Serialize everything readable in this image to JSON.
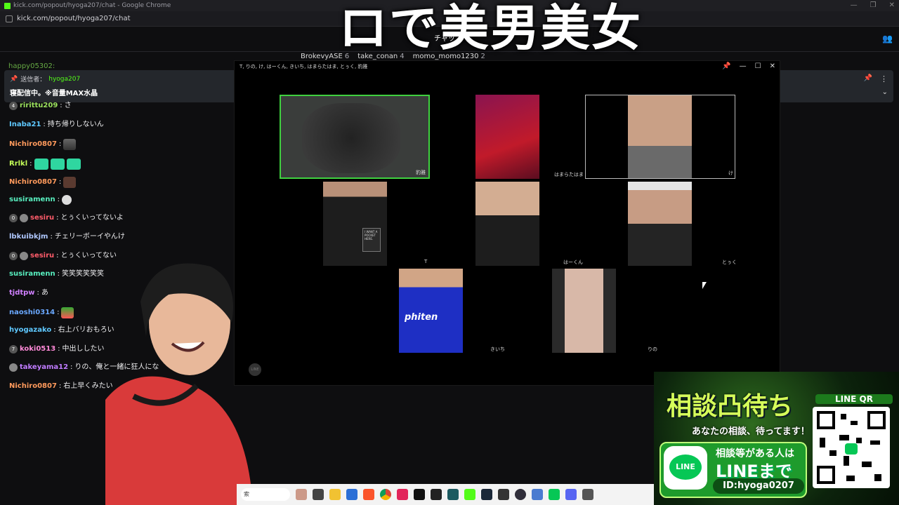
{
  "browser": {
    "title": "kick.com/popout/hyoga207/chat - Google Chrome",
    "url": "kick.com/popout/hyoga207/chat"
  },
  "overlay": {
    "caption": "ロで美男美女",
    "small_caption": "チャッ"
  },
  "top_gifters": [
    {
      "name": "BrokevyASE",
      "count": "6"
    },
    {
      "name": "take_conan",
      "count": "4"
    },
    {
      "name": "momo_momo1230",
      "count": "2"
    }
  ],
  "chat_partial_top": "happy05302:",
  "pinned": {
    "sender_label": "送信者：",
    "sender_name": "hyoga207",
    "message": "寝配信中。※音量MAX水晶"
  },
  "chat": [
    {
      "badge": "4",
      "user": "ririttu209",
      "text": "さ",
      "color": "#9be15d"
    },
    {
      "badge": "",
      "user": "Inaba21",
      "text": "持ち帰りしないん",
      "color": "#5ec8ff"
    },
    {
      "badge": "",
      "user": "Nichiro0807",
      "text": "",
      "color": "#ff9a5c"
    },
    {
      "badge": "",
      "user": "Rrlkl",
      "text": "",
      "color": "#c4ff58"
    },
    {
      "badge": "",
      "user": "Nichiro0807",
      "text": "",
      "color": "#ff9a5c"
    },
    {
      "badge": "",
      "user": "susiramenn",
      "text": "",
      "color": "#58f0c0"
    },
    {
      "badge": "0",
      "user": "sesiru",
      "text": "とぅくいってないよ",
      "color": "#ff5c6a"
    },
    {
      "badge": "",
      "user": "lbkuibkjm",
      "text": "チェリーボーイやんけ",
      "color": "#b0c8ff"
    },
    {
      "badge": "0",
      "user": "sesiru",
      "text": "とぅくいってない",
      "color": "#ff5c6a"
    },
    {
      "badge": "",
      "user": "susiramenn",
      "text": "笑笑笑笑笑笑",
      "color": "#58f0c0"
    },
    {
      "badge": "",
      "user": "tjdtpw",
      "text": "あ",
      "color": "#d080ff"
    },
    {
      "badge": "",
      "user": "naoshi0314",
      "text": "",
      "color": "#6aa8ff"
    },
    {
      "badge": "",
      "user": "hyogazako",
      "text": "右上バリおもろい",
      "color": "#5ec8ff"
    },
    {
      "badge": "7",
      "user": "koki0513",
      "text": "中出ししたい",
      "color": "#ff8ad8"
    },
    {
      "badge": "",
      "user": "takeyama12",
      "text": "りの、俺と一緒に狂人にな",
      "color": "#c07cff"
    },
    {
      "badge": "",
      "user": "Nichiro0807",
      "text": "右上早くみたい",
      "color": "#ff9a5c"
    }
  ],
  "call": {
    "title": "T, りの, け, はーくん, きいち, はまらたはま, とぅく, 豹雅",
    "participants": [
      {
        "name": "豹雅"
      },
      {
        "name": "はまらたはま"
      },
      {
        "name": "け"
      },
      {
        "name": "T"
      },
      {
        "name": "はーくん"
      },
      {
        "name": "とぅく"
      },
      {
        "name": "きいち"
      },
      {
        "name": "りの"
      }
    ],
    "shirt_text": "I WANT A POCKET HERE.",
    "phiten": "phiten",
    "line_mark": "LINE"
  },
  "taskbar": {
    "search": "索"
  },
  "ad": {
    "title": "相談凸待ち",
    "subtitle": "あなたの相談、待ってます！",
    "line_logo": "LINE",
    "line1": "相談等がある人は",
    "line2": "LINEまで",
    "id": "ID:hyoga0207",
    "qr_label": "LINE QR"
  },
  "colors": {
    "kick_green": "#53fc18",
    "pinned_bg": "#24272c",
    "line_green": "#06c755"
  }
}
